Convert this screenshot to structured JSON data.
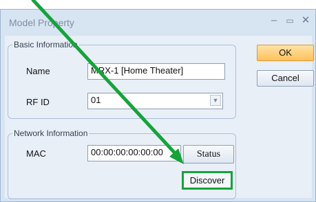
{
  "window": {
    "title": "Model Property"
  },
  "basic": {
    "legend": "Basic Information",
    "name_label": "Name",
    "name_value": "MRX-1 [Home Theater]",
    "rfid_label": "RF ID",
    "rfid_value": "01"
  },
  "network": {
    "legend": "Network Information",
    "mac_label": "MAC",
    "mac_value": "00:00:00:00:00:00",
    "status_label": "Status",
    "discover_label": "Discover"
  },
  "buttons": {
    "ok": "OK",
    "cancel": "Cancel"
  },
  "annotation": {
    "arrow_color": "#15a33a"
  }
}
